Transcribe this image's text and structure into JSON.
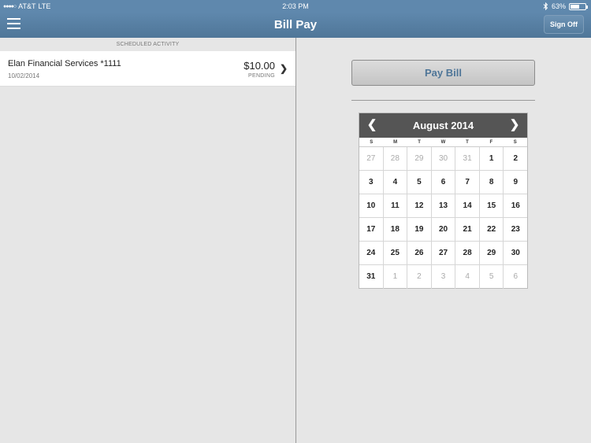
{
  "status_bar": {
    "carrier": "AT&T",
    "network": "LTE",
    "time": "2:03 PM",
    "battery_label": "63%",
    "battery_level": 0.63,
    "bluetooth_icon": "bluetooth-icon"
  },
  "nav": {
    "title": "Bill Pay",
    "menu_icon": "hamburger-menu-icon",
    "sign_off": "Sign Off"
  },
  "scheduled": {
    "header": "SCHEDULED ACTIVITY",
    "items": [
      {
        "payee": "Elan Financial Services *1111",
        "date": "10/02/2014",
        "amount": "$10.00",
        "status": "PENDING"
      }
    ]
  },
  "pay_bill_label": "Pay Bill",
  "calendar": {
    "month_label": "August 2014",
    "prev_icon": "chevron-left-icon",
    "next_icon": "chevron-right-icon",
    "weekdays": [
      "S",
      "M",
      "T",
      "W",
      "T",
      "F",
      "S"
    ],
    "weeks": [
      [
        {
          "d": "27",
          "m": true
        },
        {
          "d": "28",
          "m": true
        },
        {
          "d": "29",
          "m": true
        },
        {
          "d": "30",
          "m": true
        },
        {
          "d": "31",
          "m": true
        },
        {
          "d": "1",
          "m": false
        },
        {
          "d": "2",
          "m": false
        }
      ],
      [
        {
          "d": "3",
          "m": false
        },
        {
          "d": "4",
          "m": false
        },
        {
          "d": "5",
          "m": false
        },
        {
          "d": "6",
          "m": false
        },
        {
          "d": "7",
          "m": false
        },
        {
          "d": "8",
          "m": false
        },
        {
          "d": "9",
          "m": false
        }
      ],
      [
        {
          "d": "10",
          "m": false
        },
        {
          "d": "11",
          "m": false
        },
        {
          "d": "12",
          "m": false
        },
        {
          "d": "13",
          "m": false
        },
        {
          "d": "14",
          "m": false
        },
        {
          "d": "15",
          "m": false
        },
        {
          "d": "16",
          "m": false
        }
      ],
      [
        {
          "d": "17",
          "m": false
        },
        {
          "d": "18",
          "m": false
        },
        {
          "d": "19",
          "m": false
        },
        {
          "d": "20",
          "m": false
        },
        {
          "d": "21",
          "m": false
        },
        {
          "d": "22",
          "m": false
        },
        {
          "d": "23",
          "m": false
        }
      ],
      [
        {
          "d": "24",
          "m": false
        },
        {
          "d": "25",
          "m": false
        },
        {
          "d": "26",
          "m": false
        },
        {
          "d": "27",
          "m": false
        },
        {
          "d": "28",
          "m": false
        },
        {
          "d": "29",
          "m": false
        },
        {
          "d": "30",
          "m": false
        }
      ],
      [
        {
          "d": "31",
          "m": false
        },
        {
          "d": "1",
          "m": true
        },
        {
          "d": "2",
          "m": true
        },
        {
          "d": "3",
          "m": true
        },
        {
          "d": "4",
          "m": true
        },
        {
          "d": "5",
          "m": true
        },
        {
          "d": "6",
          "m": true
        }
      ]
    ]
  },
  "colors": {
    "nav_blue": "#5f88ad",
    "calendar_header": "#555555",
    "pay_bill_text": "#4f7698"
  }
}
